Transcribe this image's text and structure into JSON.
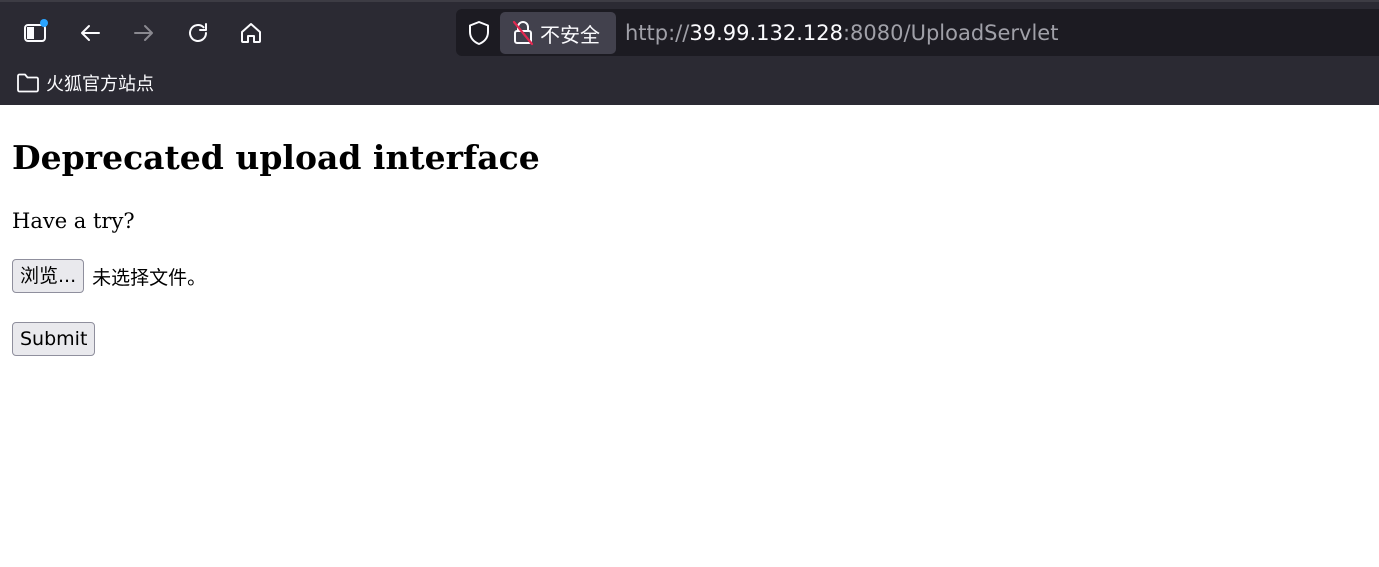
{
  "browser": {
    "security_label": "不安全",
    "url": {
      "scheme": "http://",
      "host": "39.99.132.128",
      "rest": ":8080/UploadServlet"
    },
    "bookmarks": [
      {
        "label": "火狐官方站点",
        "icon": "folder-icon"
      }
    ],
    "toolbar_icons": [
      "sidebar-icon",
      "back-icon",
      "forward-icon",
      "reload-icon",
      "home-icon",
      "shield-icon",
      "insecure-lock-icon"
    ],
    "colors": {
      "chrome_bg": "#2b2a33",
      "urlbar_bg": "#1c1b22",
      "notification_dot": "#2aa4ff",
      "insecure_slash": "#e22850"
    }
  },
  "page": {
    "heading": "Deprecated upload interface",
    "intro": "Have a try?",
    "file_input": {
      "browse_label": "浏览...",
      "status": "未选择文件。"
    },
    "submit_label": "Submit"
  }
}
